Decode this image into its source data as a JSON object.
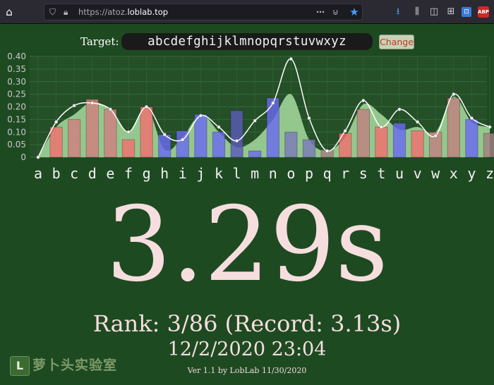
{
  "browser": {
    "url_prefix": "https://atoz.",
    "url_domain": "loblab.top",
    "icons": [
      "home-icon",
      "shield-icon",
      "lock-icon",
      "more-icon",
      "pocket-icon",
      "star-icon",
      "download-icon",
      "library-icon",
      "sidebar-icon",
      "extension-icon",
      "adblock-icon"
    ],
    "adblock_label": "ABP"
  },
  "target": {
    "label": "Target:",
    "value": "abcdefghijklmnopqrstuvwxyz",
    "button_label": "Change"
  },
  "chart_data": {
    "type": "bar",
    "categories": [
      "a",
      "b",
      "c",
      "d",
      "e",
      "f",
      "g",
      "h",
      "i",
      "j",
      "k",
      "l",
      "m",
      "n",
      "o",
      "p",
      "q",
      "r",
      "s",
      "t",
      "u",
      "v",
      "w",
      "x",
      "y",
      "z"
    ],
    "ylim": [
      0,
      0.4
    ],
    "yticks": [
      "0",
      "0.05",
      "0.10",
      "0.15",
      "0.20",
      "0.25",
      "0.30",
      "0.35",
      "0.40"
    ],
    "grid": true,
    "series": [
      {
        "values": [
          0.0,
          0.12,
          0.15,
          0.23,
          0.19,
          0.07,
          0.2,
          0.09,
          0.105,
          0.17,
          0.1,
          0.185,
          0.025,
          0.235,
          0.1,
          0.07,
          0.03,
          0.095,
          0.19,
          0.12,
          0.135,
          0.105,
          0.1,
          0.235,
          0.15,
          0.095
        ],
        "bar_colors": [
          "#f08080",
          "#f07070",
          "#d08080",
          "#d08080",
          "#d08080",
          "#f07070",
          "#f07070",
          "#6a6af0",
          "#6a6af0",
          "#6a6af0",
          "#6a6af0",
          "#5a5ab8",
          "#6a6af0",
          "#6a6af0",
          "#7a7ab8",
          "#7a7ab8",
          "#a08080",
          "#f07070",
          "#c08080",
          "#f07070",
          "#6a6af0",
          "#f07070",
          "#c08080",
          "#c08080",
          "#6a6af0",
          "#a08080"
        ]
      },
      {
        "values": [
          0.0,
          0.14,
          0.205,
          0.215,
          0.19,
          0.1,
          0.2,
          0.09,
          0.07,
          0.165,
          0.12,
          0.065,
          0.145,
          0.215,
          0.39,
          0.155,
          0.025,
          0.105,
          0.225,
          0.12,
          0.19,
          0.14,
          0.085,
          0.25,
          0.155,
          0.12
        ],
        "color": "#ffffff"
      },
      {
        "values": [
          0.0,
          0.12,
          0.17,
          0.22,
          0.185,
          0.1,
          0.2,
          0.03,
          0.08,
          0.17,
          0.1,
          0.04,
          0.07,
          0.15,
          0.25,
          0.07,
          0.025,
          0.08,
          0.21,
          0.17,
          0.11,
          0.12,
          0.1,
          0.24,
          0.14,
          0.12
        ],
        "color": "#a8dca0"
      }
    ]
  },
  "result": {
    "time": "3.29s",
    "rank": "Rank: 3/86 (Record: 3.13s)",
    "datetime": "12/2/2020 23:04",
    "version": "Ver 1.1 by LobLab 11/30/2020"
  },
  "logo": {
    "text": "萝卜头实验室",
    "mark": "L"
  },
  "colors": {
    "background": "#1e4a22",
    "text": "#f6dede",
    "curve": "#ffffff",
    "area": "#a8dca0"
  }
}
